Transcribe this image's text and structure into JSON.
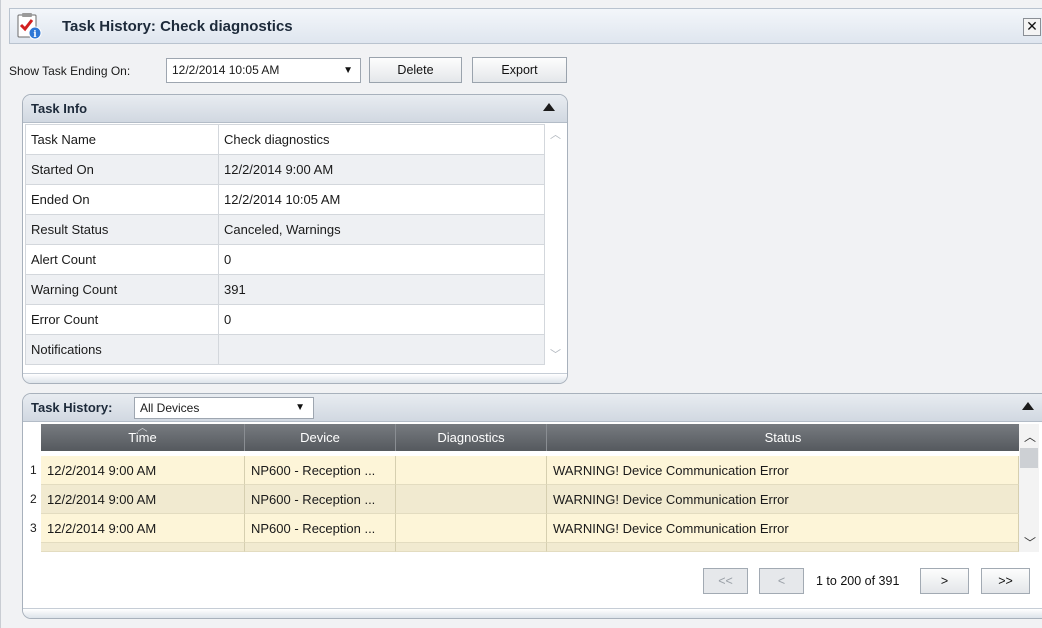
{
  "window": {
    "title": "Task History: Check diagnostics",
    "close_label": "✕"
  },
  "toolbar": {
    "show_label": "Show Task Ending On:",
    "ending_on_value": "12/2/2014 10:05 AM",
    "delete_label": "Delete",
    "export_label": "Export"
  },
  "task_info": {
    "title": "Task Info",
    "rows": [
      {
        "label": "Task Name",
        "value": "Check diagnostics"
      },
      {
        "label": "Started On",
        "value": "12/2/2014 9:00 AM"
      },
      {
        "label": "Ended On",
        "value": "12/2/2014 10:05 AM"
      },
      {
        "label": "Result Status",
        "value": "Canceled, Warnings"
      },
      {
        "label": "Alert Count",
        "value": "0"
      },
      {
        "label": "Warning Count",
        "value": "391"
      },
      {
        "label": "Error Count",
        "value": "0"
      },
      {
        "label": "Notifications",
        "value": ""
      }
    ]
  },
  "history": {
    "title": "Task History:",
    "filter_value": "All Devices",
    "columns": [
      "Time",
      "Device",
      "Diagnostics",
      "Status"
    ],
    "rows": [
      {
        "num": "1",
        "time": "12/2/2014 9:00 AM",
        "device": "NP600 - Reception ...",
        "diagnostics": "",
        "status": "WARNING! Device Communication Error"
      },
      {
        "num": "2",
        "time": "12/2/2014 9:00 AM",
        "device": "NP600 - Reception ...",
        "diagnostics": "",
        "status": "WARNING! Device Communication Error"
      },
      {
        "num": "3",
        "time": "12/2/2014 9:00 AM",
        "device": "NP600 - Reception ...",
        "diagnostics": "",
        "status": "WARNING! Device Communication Error"
      }
    ],
    "pager": {
      "first_label": "<<",
      "prev_label": "<",
      "info": "1 to 200 of 391",
      "next_label": ">",
      "last_label": ">>"
    }
  },
  "colors": {
    "row_odd": "#fdf5d8",
    "row_even": "#f1ead0",
    "header_dark": "#5e6267",
    "panel_border": "#a8b1bc"
  }
}
